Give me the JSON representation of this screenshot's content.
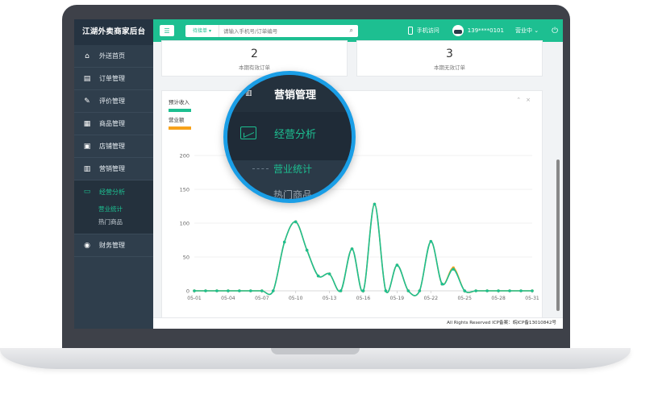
{
  "brand": "江湖外卖商家后台",
  "sidebar": {
    "items": [
      {
        "label": "外送首页",
        "icon": "home-icon"
      },
      {
        "label": "订单管理",
        "icon": "order-icon"
      },
      {
        "label": "评价管理",
        "icon": "edit-icon"
      },
      {
        "label": "商品管理",
        "icon": "grid-icon"
      },
      {
        "label": "店铺管理",
        "icon": "store-icon"
      },
      {
        "label": "营销管理",
        "icon": "bar-chart-icon"
      },
      {
        "label": "经营分析",
        "icon": "monitor-chart-icon",
        "sub": [
          "营业统计",
          "热门商品"
        ]
      },
      {
        "label": "财务管理",
        "icon": "money-icon"
      }
    ]
  },
  "topbar": {
    "search_filter": "待接单",
    "search_placeholder": "请输入手机号/订单编号",
    "mobile_label": "手机访问",
    "user": "139****0101",
    "status": "营业中"
  },
  "stats": [
    {
      "value": "2",
      "label": "本期有效订单"
    },
    {
      "value": "3",
      "label": "本期无效订单"
    }
  ],
  "legend": {
    "income": "预计收入",
    "revenue": "营业额"
  },
  "colors": {
    "accent": "#1dbf91",
    "revenue": "#f7a21b",
    "sidebar": "#2f3e4c"
  },
  "footer": "All Rights Reserved ICP备案：皖ICP备13010842号",
  "magnifier": {
    "title": "营销管理",
    "active": "经营分析",
    "sub1": "营业统计",
    "sub2": "热门商品"
  },
  "chart_data": {
    "type": "line",
    "x": [
      "05-01",
      "05-02",
      "05-03",
      "05-04",
      "05-05",
      "05-06",
      "05-07",
      "05-08",
      "05-09",
      "05-10",
      "05-11",
      "05-12",
      "05-13",
      "05-14",
      "05-15",
      "05-16",
      "05-17",
      "05-18",
      "05-19",
      "05-20",
      "05-21",
      "05-22",
      "05-23",
      "05-24",
      "05-25",
      "05-26",
      "05-27",
      "05-28",
      "05-29",
      "05-30",
      "05-31"
    ],
    "xticks": [
      "05-01",
      "05-04",
      "05-07",
      "05-10",
      "05-13",
      "05-16",
      "05-19",
      "05-22",
      "05-25",
      "05-28",
      "05-31"
    ],
    "series": [
      {
        "name": "预计收入",
        "color": "#1dbf91",
        "values": [
          0,
          0,
          0,
          0,
          0,
          0,
          0,
          0,
          72,
          102,
          60,
          22,
          25,
          0,
          62,
          0,
          128,
          0,
          38,
          0,
          0,
          73,
          10,
          32,
          0,
          0,
          0,
          0,
          0,
          0,
          0
        ]
      },
      {
        "name": "营业额",
        "color": "#f7a21b",
        "values": [
          0,
          0,
          0,
          0,
          0,
          0,
          0,
          0,
          72,
          102,
          60,
          22,
          25,
          0,
          62,
          0,
          128,
          0,
          38,
          0,
          0,
          73,
          10,
          34,
          0,
          0,
          0,
          0,
          0,
          0,
          0
        ]
      }
    ],
    "ylim": [
      0,
      200
    ],
    "yticks": [
      0,
      50,
      100,
      150,
      200
    ],
    "grid": true
  }
}
